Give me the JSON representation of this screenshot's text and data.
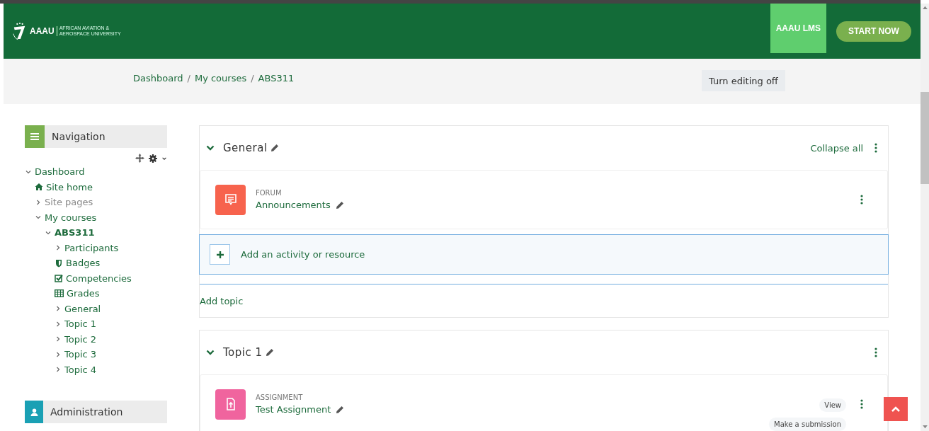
{
  "header": {
    "logo": {
      "mark": "AAAU",
      "subtitle_lines": [
        "AFRICAN AVIATION &",
        "AEROSPACE UNIVERSITY"
      ]
    },
    "site_link": "AAAU LMS",
    "cta": "START NOW"
  },
  "breadcrumb": {
    "separator": "/",
    "items": [
      "Dashboard",
      "My courses",
      "ABS311"
    ]
  },
  "edit_button": "Turn editing off",
  "navigation": {
    "title": "Navigation",
    "items": [
      {
        "label": "Dashboard",
        "kind": "expandable",
        "expanded": true,
        "selected": false,
        "muted": false,
        "children": [
          {
            "label": "Site home",
            "kind": "home",
            "selected": false,
            "muted": false
          },
          {
            "label": "Site pages",
            "kind": "expandable",
            "expanded": false,
            "selected": false,
            "muted": true
          },
          {
            "label": "My courses",
            "kind": "expandable",
            "expanded": true,
            "selected": false,
            "muted": false,
            "children": [
              {
                "label": "ABS311",
                "kind": "expandable",
                "expanded": true,
                "selected": true,
                "muted": false,
                "children": [
                  {
                    "label": "Participants",
                    "kind": "expandable",
                    "expanded": false,
                    "selected": false,
                    "muted": false
                  },
                  {
                    "label": "Badges",
                    "kind": "badge",
                    "selected": false,
                    "muted": false
                  },
                  {
                    "label": "Competencies",
                    "kind": "check",
                    "selected": false,
                    "muted": false
                  },
                  {
                    "label": "Grades",
                    "kind": "table",
                    "selected": false,
                    "muted": false
                  },
                  {
                    "label": "General",
                    "kind": "expandable",
                    "expanded": false,
                    "selected": false,
                    "muted": false
                  },
                  {
                    "label": "Topic 1",
                    "kind": "expandable",
                    "expanded": false,
                    "selected": false,
                    "muted": false
                  },
                  {
                    "label": "Topic 2",
                    "kind": "expandable",
                    "expanded": false,
                    "selected": false,
                    "muted": false
                  },
                  {
                    "label": "Topic 3",
                    "kind": "expandable",
                    "expanded": false,
                    "selected": false,
                    "muted": false
                  },
                  {
                    "label": "Topic 4",
                    "kind": "expandable",
                    "expanded": false,
                    "selected": false,
                    "muted": false
                  }
                ]
              }
            ]
          }
        ]
      }
    ]
  },
  "administration": {
    "title": "Administration"
  },
  "sections": [
    {
      "title": "General",
      "expanded": true,
      "collapse_all": "Collapse all",
      "activities": [
        {
          "kind": "forum",
          "type_label": "FORUM",
          "name": "Announcements"
        }
      ],
      "add_activity": "Add an activity or resource",
      "add_topic": "Add topic"
    },
    {
      "title": "Topic 1",
      "expanded": true,
      "activities": [
        {
          "kind": "assignment",
          "type_label": "ASSIGNMENT",
          "name": "Test Assignment",
          "buttons": [
            "View",
            "Make a submission"
          ]
        }
      ]
    }
  ]
}
